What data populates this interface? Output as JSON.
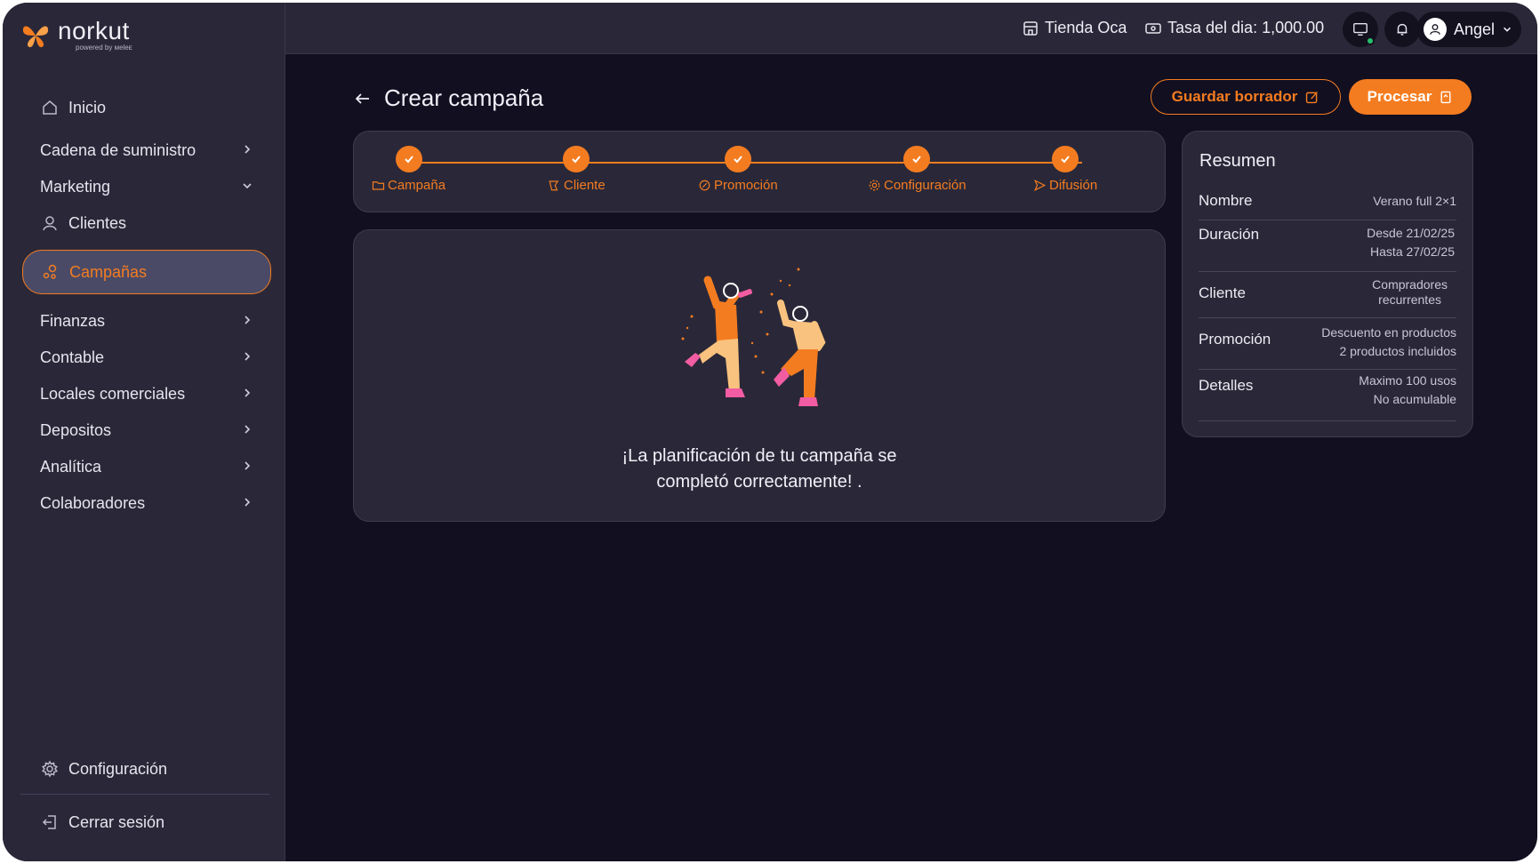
{
  "app": {
    "brand": "norkut",
    "brand_sub": "powered by ᴍeleᴇ"
  },
  "sidebar": {
    "items": [
      {
        "label": "Inicio",
        "icon": "home-icon"
      },
      {
        "label": "Cadena de suministro",
        "icon": "chevron-right-icon"
      },
      {
        "label": "Marketing",
        "icon": "chevron-down-icon"
      },
      {
        "label": "Clientes",
        "icon": "user-icon"
      },
      {
        "label": "Campañas",
        "icon": "campaign-icon",
        "active": true
      },
      {
        "label": "Finanzas",
        "icon": "chevron-right-icon"
      },
      {
        "label": "Contable",
        "icon": "chevron-right-icon"
      },
      {
        "label": "Locales comerciales",
        "icon": "chevron-right-icon"
      },
      {
        "label": "Depositos",
        "icon": "chevron-right-icon"
      },
      {
        "label": "Analítica",
        "icon": "chevron-right-icon"
      },
      {
        "label": "Colaboradores",
        "icon": "chevron-right-icon"
      }
    ],
    "settings_label": "Configuración",
    "logout_label": "Cerrar sesión"
  },
  "topbar": {
    "store": "Tienda Oca",
    "rate": "Tasa del dia: 1,000.00",
    "user": "Angel"
  },
  "page": {
    "title": "Crear campaña",
    "save_draft": "Guardar borrador",
    "process": "Procesar"
  },
  "stepper": {
    "steps": [
      "Campaña",
      "Cliente",
      "Promoción",
      "Configuración",
      "Difusión"
    ]
  },
  "success": {
    "line1": "¡La planificación de tu campaña se",
    "line2": "completó correctamente! ."
  },
  "summary": {
    "title": "Resumen",
    "rows": [
      {
        "label": "Nombre",
        "lines": [
          "Verano full 2×1"
        ]
      },
      {
        "label": "Duración",
        "lines": [
          "Desde 21/02/25",
          "Hasta 27/02/25"
        ]
      },
      {
        "label": "Cliente",
        "lines": [
          "Compradores",
          "recurrentes"
        ]
      },
      {
        "label": "Promoción",
        "lines": [
          "Descuento en productos",
          "2 productos incluidos"
        ]
      },
      {
        "label": "Detalles",
        "lines": [
          "Maximo 100 usos",
          "No acumulable"
        ]
      }
    ]
  },
  "colors": {
    "accent": "#f47c20",
    "background": "#120f20",
    "panel": "#2a2838",
    "online": "#23c16b"
  }
}
